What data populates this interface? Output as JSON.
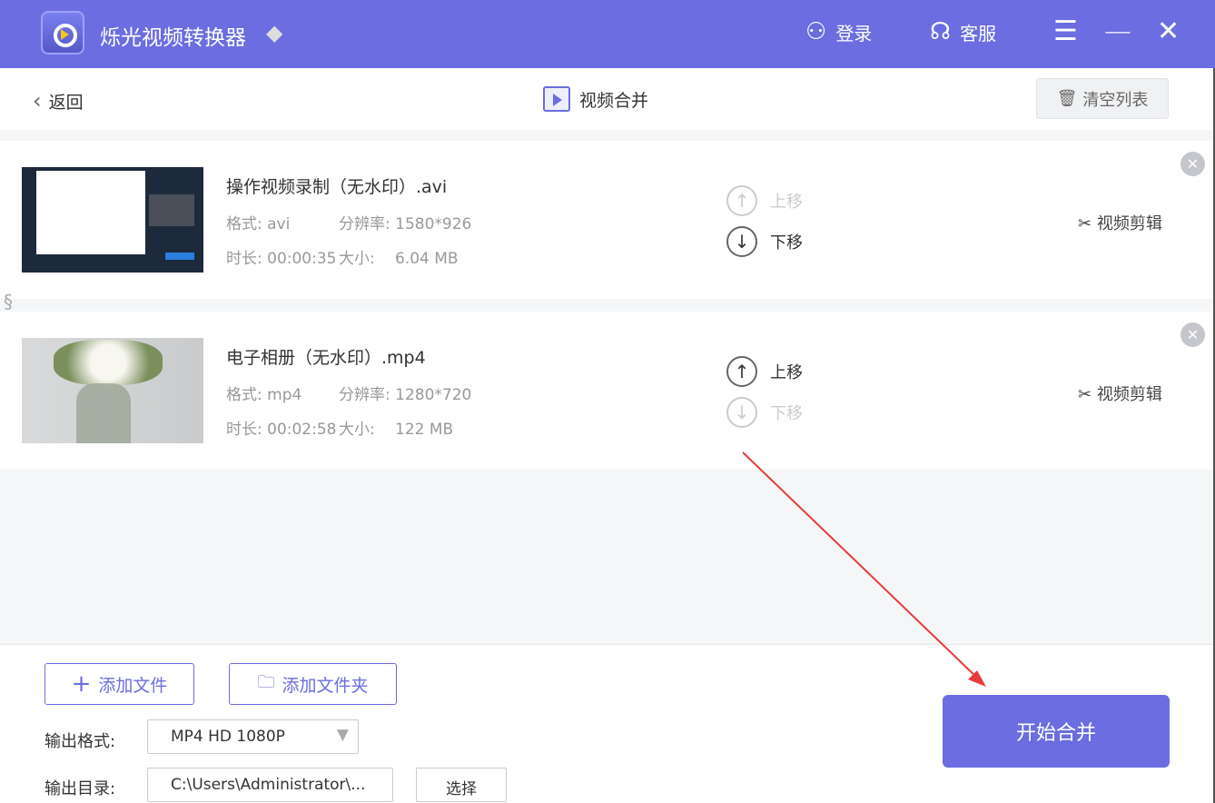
{
  "app": {
    "title": "烁光视频转换器",
    "login": "登录",
    "support": "客服"
  },
  "topbar": {
    "back": "返回",
    "title": "视频合并",
    "clear": "清空列表"
  },
  "files": [
    {
      "name": "操作视频录制（无水印）.avi",
      "format_label": "格式: avi",
      "resolution_label": "分辨率: 1580*926",
      "duration_label": "时长: 00:00:35",
      "size_label": "大小:",
      "size": "6.04 MB",
      "up": "上移",
      "down": "下移",
      "edit": "视频剪辑"
    },
    {
      "name": "电子相册（无水印）.mp4",
      "format_label": "格式: mp4",
      "resolution_label": "分辨率: 1280*720",
      "duration_label": "时长: 00:02:58",
      "size_label": "大小:",
      "size": "122 MB",
      "up": "上移",
      "down": "下移",
      "edit": "视频剪辑"
    }
  ],
  "bottom": {
    "add_file": "添加文件",
    "add_folder": "添加文件夹",
    "format_label": "输出格式:",
    "format_value": "MP4 HD 1080P",
    "dir_label": "输出目录:",
    "dir_value": "C:\\Users\\Administrator\\...",
    "choose": "选择",
    "start": "开始合并"
  }
}
